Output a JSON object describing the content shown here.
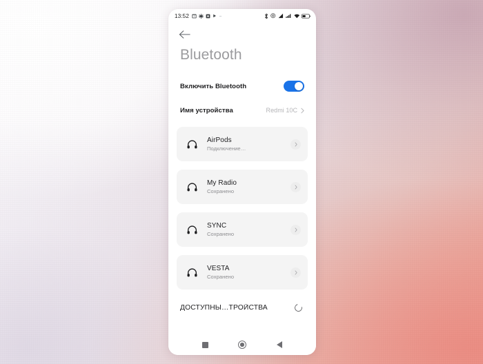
{
  "background": {
    "accent_pink": "#ec9b90",
    "accent_mauve": "#c4a0af",
    "accent_lavender": "#ded7e4",
    "base_white": "#fefeff"
  },
  "statusbar": {
    "time": "13:52",
    "left_icons": [
      "calendar-icon",
      "settings-gear-icon",
      "app-notification-icon",
      "play-icon",
      "more-dot-icon"
    ],
    "right_icons": [
      "bluetooth-icon",
      "alarm-icon",
      "signal-sim1-icon",
      "signal-sim2-icon",
      "wifi-icon",
      "battery-icon"
    ]
  },
  "topbar": {
    "back_label": "back-arrow"
  },
  "header": {
    "title": "Bluetooth"
  },
  "settings": {
    "enable": {
      "label": "Включить Bluetooth",
      "on": true,
      "accent": "#1a73e8"
    },
    "device_name": {
      "label": "Имя устройства",
      "value": "Redmi 10C"
    }
  },
  "paired_devices": [
    {
      "name": "AirPods",
      "status": "Подключение…",
      "icon": "headphones-icon"
    },
    {
      "name": "My Radio",
      "status": "Сохранено",
      "icon": "headphones-icon"
    },
    {
      "name": "SYNC",
      "status": "Сохранено",
      "icon": "headphones-icon"
    },
    {
      "name": "VESTA",
      "status": "Сохранено",
      "icon": "headphones-icon"
    }
  ],
  "available_section": {
    "label": "ДОСТУПНЫ…ТРОЙСТВА",
    "refreshing": true
  },
  "navbar": {
    "recents_label": "recents-square-button",
    "home_label": "home-circle-button",
    "back_label": "back-triangle-button"
  }
}
